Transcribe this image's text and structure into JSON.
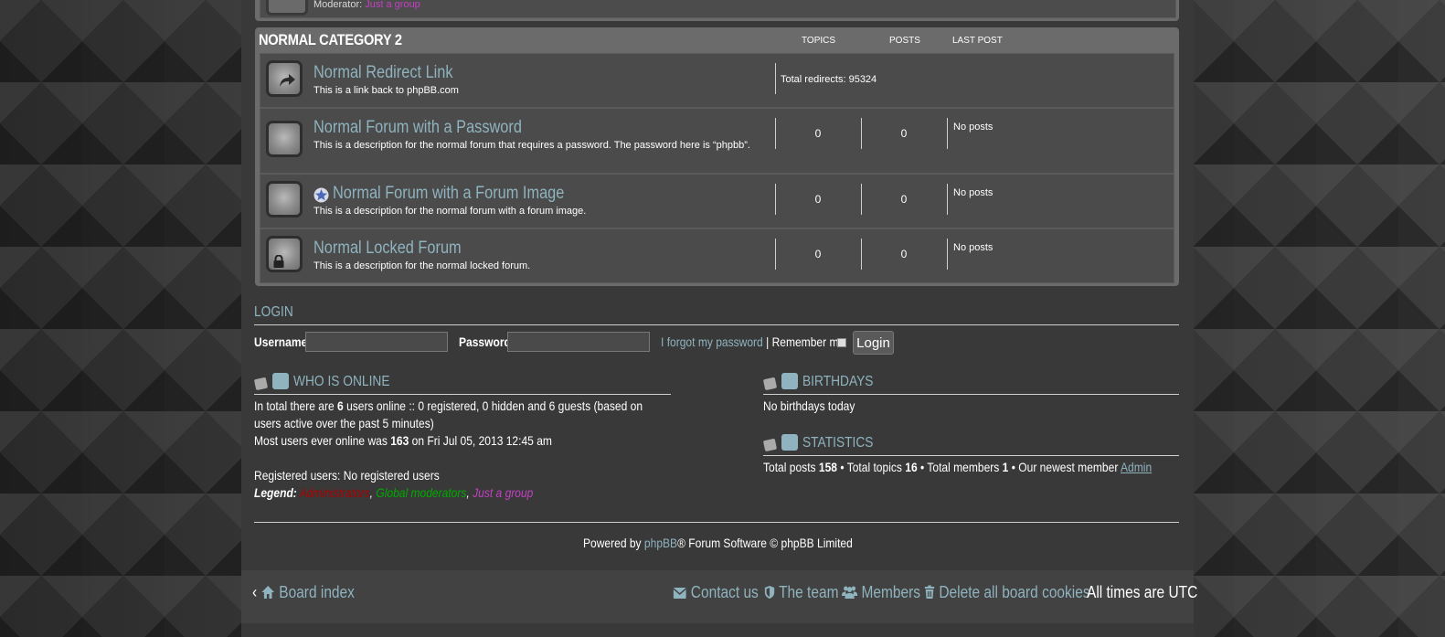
{
  "prev_category": {
    "moderator_label": "Moderator:",
    "moderator_group": "Just a group"
  },
  "category": {
    "title": "NORMAL CATEGORY 2",
    "col_topics": "TOPICS",
    "col_posts": "POSTS",
    "col_last_post": "LAST POST",
    "forums": [
      {
        "title": "Normal Redirect Link",
        "desc": "This is a link back to phpBB.com",
        "redirects": "Total redirects: 95324"
      },
      {
        "title": "Normal Forum with a Password",
        "desc": "This is a description for the normal forum that requires a password. The password here is “phpbb”.",
        "topics": "0",
        "posts": "0",
        "last_post": "No posts"
      },
      {
        "title": "Normal Forum with a Forum Image",
        "desc": "This is a description for the normal forum with a forum image.",
        "topics": "0",
        "posts": "0",
        "last_post": "No posts"
      },
      {
        "title": "Normal Locked Forum",
        "desc": "This is a description for the normal locked forum.",
        "topics": "0",
        "posts": "0",
        "last_post": "No posts"
      }
    ]
  },
  "login": {
    "title": "LOGIN",
    "username_label": "Username:",
    "password_label": "Password:",
    "forgot": "I forgot my password",
    "sep": "|",
    "remember": "Remember me",
    "button": "Login"
  },
  "online": {
    "title": "WHO IS ONLINE",
    "line1_a": "In total there are ",
    "line1_b": "6",
    "line1_c": " users online :: 0 registered, 0 hidden and 6 guests (based on",
    "line2": "users active over the past 5 minutes)",
    "line3_a": "Most users ever online was ",
    "line3_b": "163",
    "line3_c": " on Fri Jul 05, 2013 12:45 am",
    "registered": "Registered users: No registered users",
    "legend_label": "Legend:",
    "legend_admin": "Administrators",
    "legend_global": "Global moderators",
    "legend_group": "Just a group",
    "comma": ","
  },
  "birthdays": {
    "title": "BIRTHDAYS",
    "text": "No birthdays today"
  },
  "statistics": {
    "title": "STATISTICS",
    "a": "Total posts ",
    "posts": "158",
    "b": " • Total topics ",
    "topics": "16",
    "c": " • Total members ",
    "members": "1",
    "d": " • Our newest member ",
    "newest": "Admin"
  },
  "footer": {
    "powered_a": "Powered by ",
    "powered_link": "phpBB",
    "powered_b": "® Forum Software © phpBB Limited",
    "board_index": "Board index",
    "contact": "Contact us",
    "team": "The team",
    "members": "Members",
    "cookies": "Delete all board cookies",
    "timezone": "All times are UTC"
  },
  "colors": {
    "link": "#8fb3bf",
    "admin": "#aa0000",
    "global_mod": "#00aa00",
    "group": "#c340c3"
  }
}
